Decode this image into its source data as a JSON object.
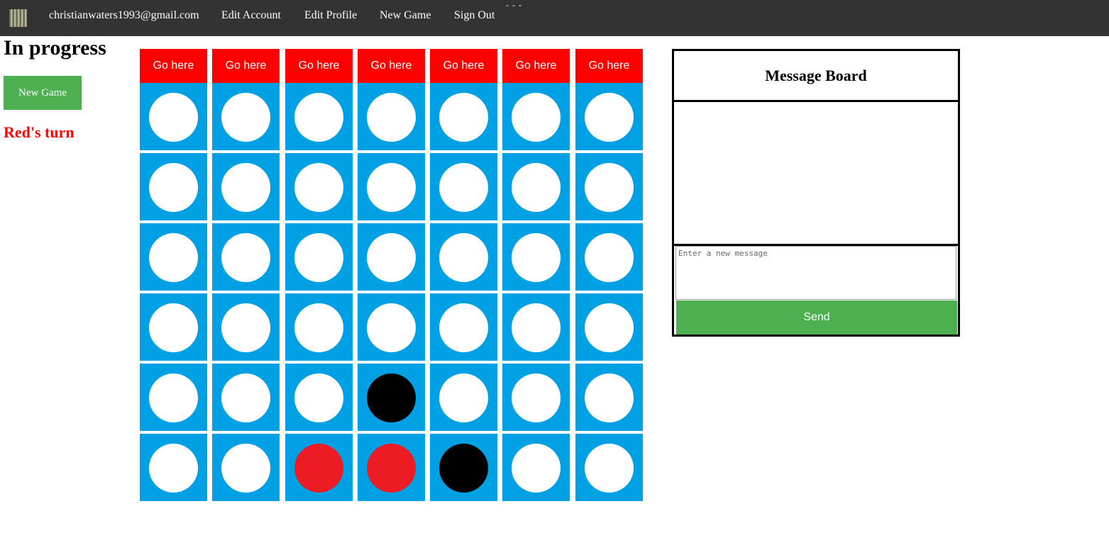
{
  "nav": {
    "user_email": "christianwaters1993@gmail.com",
    "edit_account": "Edit Account",
    "edit_profile": "Edit Profile",
    "new_game": "New Game",
    "sign_out": "Sign Out",
    "dashes": "- - -"
  },
  "game": {
    "status": "In progress",
    "new_game_button": "New Game",
    "turn": "Red's turn",
    "drop_button_label": "Go here",
    "columns": 7,
    "rows": 6,
    "grid": [
      [
        "empty",
        "empty",
        "empty",
        "empty",
        "empty",
        "empty",
        "empty"
      ],
      [
        "empty",
        "empty",
        "empty",
        "empty",
        "empty",
        "empty",
        "empty"
      ],
      [
        "empty",
        "empty",
        "empty",
        "empty",
        "empty",
        "empty",
        "empty"
      ],
      [
        "empty",
        "empty",
        "empty",
        "empty",
        "empty",
        "empty",
        "empty"
      ],
      [
        "empty",
        "empty",
        "empty",
        "black",
        "empty",
        "empty",
        "empty"
      ],
      [
        "empty",
        "empty",
        "red",
        "red",
        "black",
        "empty",
        "empty"
      ]
    ],
    "colors": {
      "board": "#00a0e4",
      "red": "#ed1c24",
      "black": "#000000",
      "empty": "#ffffff",
      "drop_button": "#ff0000",
      "turn_text": "#ff0000"
    }
  },
  "message_board": {
    "title": "Message Board",
    "input_placeholder": "Enter a new message",
    "send_button": "Send"
  }
}
